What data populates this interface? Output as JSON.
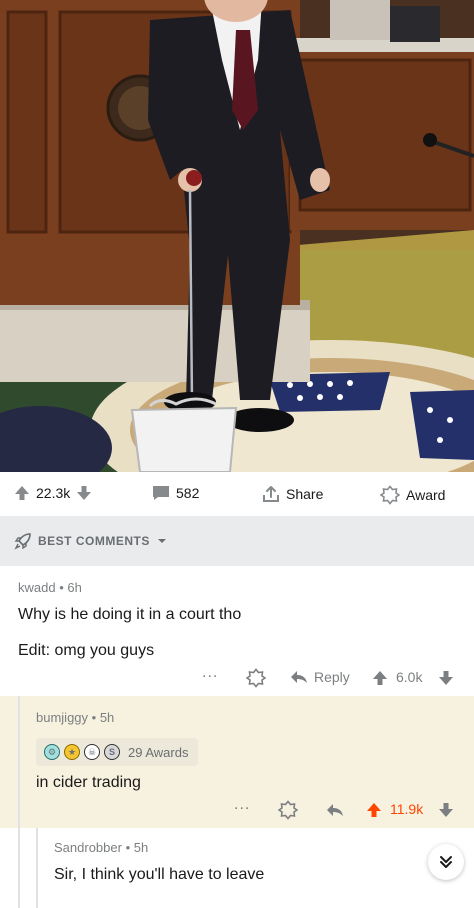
{
  "post": {
    "upvotes": "22.3k",
    "comments": "582",
    "share_label": "Share",
    "award_label": "Award"
  },
  "sort": {
    "label": "BEST COMMENTS"
  },
  "comments": [
    {
      "author": "kwadd",
      "age": "6h",
      "body": "Why is he doing it in a court tho",
      "edit": "Edit: omg you guys",
      "more": "...",
      "reply_label": "Reply",
      "score": "6.0k"
    },
    {
      "author": "bumjiggy",
      "age": "5h",
      "awards_label": "29 Awards",
      "body": "in cider trading",
      "more": "...",
      "score": "11.9k"
    },
    {
      "author": "Sandrobber",
      "age": "5h",
      "body": "Sir, I think you'll have to leave"
    }
  ],
  "colors": {
    "upvote_active": "#ff4500",
    "muted": "#878a8c",
    "highlight_bg": "#f7f2df",
    "sort_bg": "#e9ebed"
  },
  "icons": [
    "upvote-icon",
    "downvote-icon",
    "comment-icon",
    "share-icon",
    "award-icon",
    "rocket-icon",
    "chevron-down-icon",
    "reply-icon",
    "double-chevron-down-icon"
  ]
}
